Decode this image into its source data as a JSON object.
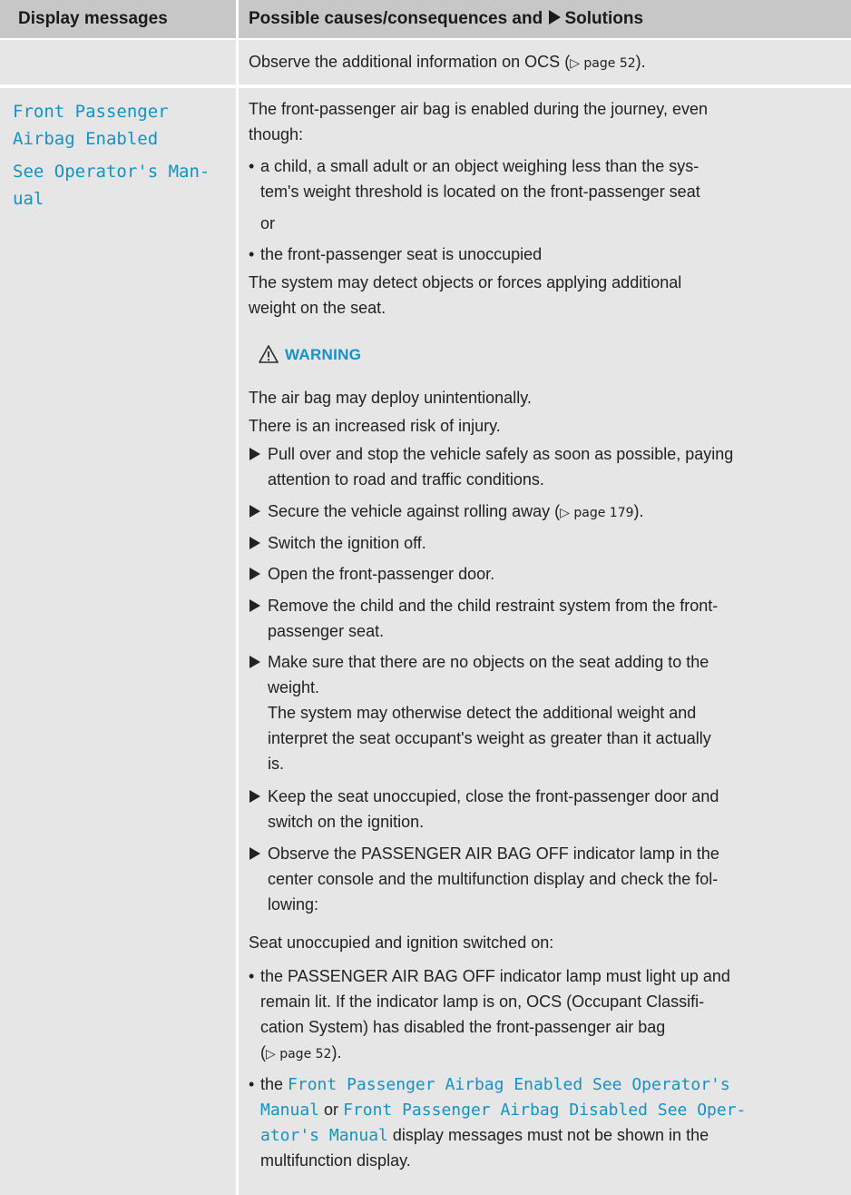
{
  "header": {
    "col1": "Display messages",
    "col2_prefix": "Possible causes/consequences and",
    "col2_suffix": "Solutions"
  },
  "row1": {
    "text_a": "Observe the additional information on OCS (",
    "page_ref": "▷ page 52",
    "text_b": ")."
  },
  "row2": {
    "message_lines": [
      "Front Passenger",
      "Airbag Enabled",
      "See Operator's Man-",
      "ual"
    ],
    "intro_lines": [
      "The front-passenger air bag is enabled during the journey, even",
      "though:"
    ],
    "bullet1_lines": [
      "a child, a small adult or an object weighing less than the sys-",
      "tem's weight threshold is located on the front-passenger seat"
    ],
    "or_text": "or",
    "bullet2": "the front-passenger seat is unoccupied",
    "detect_lines": [
      "The system may detect objects or forces applying additional",
      "weight on the seat."
    ],
    "warning_label": "WARNING",
    "warning_lines": [
      "The air bag may deploy unintentionally.",
      "There is an increased risk of injury."
    ],
    "steps": {
      "s1": [
        "Pull over and stop the vehicle safely as soon as possible, paying",
        "attention to road and traffic conditions."
      ],
      "s2_a": "Secure the vehicle against rolling away (",
      "s2_ref": "▷ page 179",
      "s2_b": ").",
      "s3": "Switch the ignition off.",
      "s4": "Open the front-passenger door.",
      "s5": [
        "Remove the child and the child restraint system from the front-",
        "passenger seat."
      ],
      "s6": [
        "Make sure that there are no objects on the seat adding to the",
        "weight."
      ],
      "s6_note": [
        "The system may otherwise detect the additional weight and",
        "interpret the seat occupant's weight as greater than it actually",
        "is."
      ],
      "s7": [
        "Keep the seat unoccupied, close the front-passenger door and",
        "switch on the ignition."
      ],
      "s8": [
        "Observe the PASSENGER AIR BAG OFF indicator lamp in the",
        "center console and the multifunction display and check the fol-",
        "lowing:"
      ]
    },
    "seat_unoccupied": "Seat unoccupied and ignition switched on:",
    "check1_lines": [
      "the PASSENGER AIR BAG OFF indicator lamp must light up and",
      "remain lit. If the indicator lamp is on, OCS (Occupant Classifi-",
      "cation System) has disabled the front-passenger air bag"
    ],
    "check1_ref": "▷ page 52",
    "check2": {
      "l1_a": "the",
      "l1_m": "Front Passenger Airbag Enabled See Operator's",
      "l2_m1": "Manual",
      "l2_b": "or",
      "l2_m2": "Front Passenger Airbag Disabled See Oper-",
      "l3_m": "ator's Manual",
      "l3_b": "display messages must not be shown in the",
      "l4": "multifunction display."
    }
  }
}
